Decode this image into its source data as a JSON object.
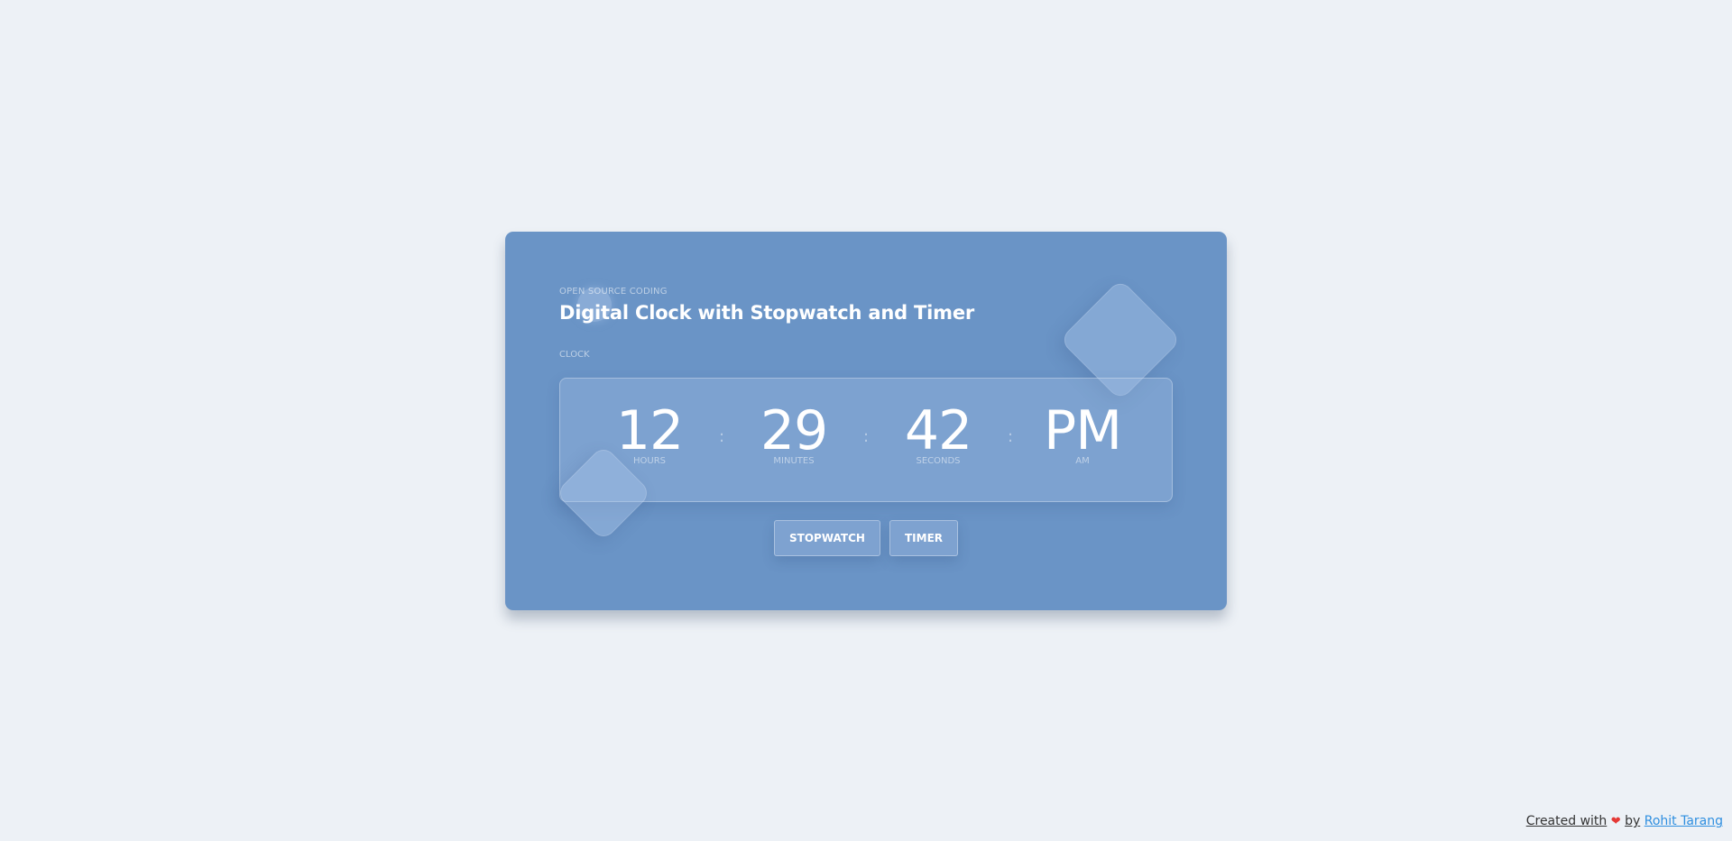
{
  "header": {
    "eyebrow": "OPEN SOURCE CODING",
    "title": "Digital Clock with Stopwatch and Timer"
  },
  "section_label": "CLOCK",
  "clock": {
    "hours": "12",
    "hours_label": "HOURS",
    "minutes": "29",
    "minutes_label": "MINUTES",
    "seconds": "42",
    "seconds_label": "SECONDS",
    "period": "PM",
    "period_label": "AM",
    "separator": ":"
  },
  "buttons": {
    "stopwatch": "STOPWATCH",
    "timer": "TIMER"
  },
  "footer": {
    "created_with": "Created with",
    "heart_icon": "heart-icon",
    "by": "by",
    "author": "Rohit Tarang"
  },
  "colors": {
    "page_background": "#edf1f6",
    "card": "#6a94c6",
    "link": "#2f8fe0",
    "heart": "#e53935"
  }
}
